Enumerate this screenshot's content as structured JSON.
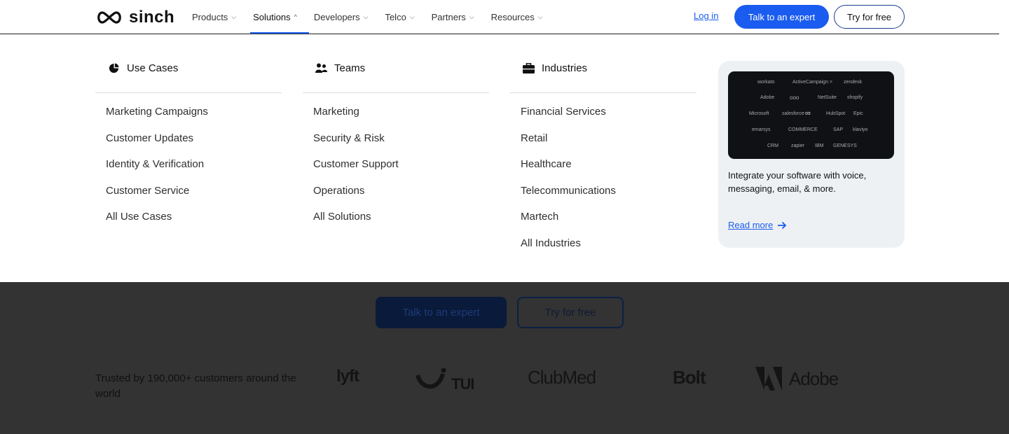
{
  "brand": {
    "name": "sinch",
    "logo_icon": "infinity-icon"
  },
  "nav": {
    "items": [
      {
        "label": "Products",
        "icon": "chevron-down-icon"
      },
      {
        "label": "Solutions",
        "icon": "chevron-up-icon",
        "active": true
      },
      {
        "label": "Developers",
        "icon": "chevron-down-icon"
      },
      {
        "label": "Telco",
        "icon": "chevron-down-icon"
      },
      {
        "label": "Partners",
        "icon": "chevron-down-icon"
      },
      {
        "label": "Resources",
        "icon": "chevron-down-icon"
      }
    ],
    "login": "Log in",
    "cta_primary": "Talk to an expert",
    "cta_secondary": "Try for free"
  },
  "mega_menu": {
    "columns": [
      {
        "title": "Use Cases",
        "icon": "pie-chart-icon",
        "items": [
          "Marketing Campaigns",
          "Customer Updates",
          "Identity & Verification",
          "Customer Service",
          "All Use Cases"
        ]
      },
      {
        "title": "Teams",
        "icon": "people-icon",
        "items": [
          "Marketing",
          "Security & Risk",
          "Customer Support",
          "Operations",
          "All Solutions"
        ]
      },
      {
        "title": "Industries",
        "icon": "briefcase-icon",
        "items": [
          "Financial Services",
          "Retail",
          "Healthcare",
          "Telecommunications",
          "Martech",
          "All Industries"
        ]
      }
    ],
    "promo": {
      "logos": [
        [
          "workato",
          "ActiveCampaign >",
          "zendesk"
        ],
        [
          "Adobe",
          "ooo",
          "NetSuite",
          "shopify"
        ],
        [
          "Microsoft",
          "salesforce",
          "∞",
          "HubSpot",
          "Epic"
        ],
        [
          "emarsys",
          "COMMERCE",
          "SAP",
          "klaviyo"
        ],
        [
          "CRM",
          "zapier",
          "IBM",
          "GENESYS"
        ]
      ],
      "text": "Integrate your software with voice, messaging, email, & more.",
      "link": "Read more",
      "link_icon": "arrow-right-icon"
    }
  },
  "background": {
    "cta_primary": "Talk to an expert",
    "cta_secondary": "Try for free",
    "trusted": "Trusted by 190,000+ customers around the world",
    "customer_logos": [
      "lyft",
      "TUI",
      "ClubMed",
      "Bolt",
      "Adobe"
    ]
  },
  "colors": {
    "accent": "#1a5cf0",
    "overlay": "#333333",
    "promo_bg": "#eef1f4"
  }
}
